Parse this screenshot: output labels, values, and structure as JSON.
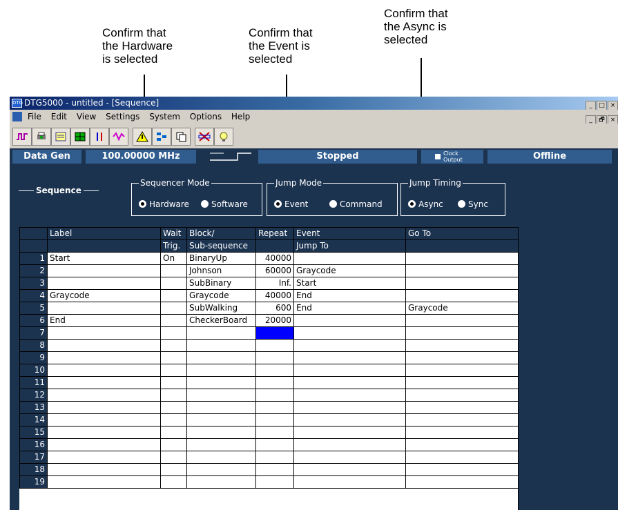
{
  "callouts": [
    {
      "lines": [
        "Confirm that",
        "the Hardware",
        "is selected"
      ]
    },
    {
      "lines": [
        "Confirm that",
        "the Event is",
        "selected"
      ]
    },
    {
      "lines": [
        "Confirm that",
        "the Async is",
        "selected"
      ]
    }
  ],
  "window": {
    "title": "DTG5000 - untitled - [Sequence]",
    "app_icon": "dtg-app-icon",
    "controls": {
      "minimize": "_",
      "maximize": "□",
      "close": "×",
      "restore": "🗗"
    }
  },
  "menu": [
    "File",
    "Edit",
    "View",
    "Settings",
    "System",
    "Options",
    "Help"
  ],
  "toolbar_icons": [
    "waveform-icon",
    "print-icon",
    "listing-icon",
    "grid-icon",
    "timing-icon",
    "pattern-icon",
    "warning-icon",
    "sequence-icon",
    "copy-icon",
    "scope-icon",
    "probe-icon"
  ],
  "status": {
    "mode": "Data Gen",
    "frequency": "100.00000 MHz",
    "run_state": "Stopped",
    "clock_output": "Clock Output",
    "connection": "Offline"
  },
  "sequence_label": "Sequence",
  "sequencer_mode": {
    "title": "Sequencer Mode",
    "options": [
      "Hardware",
      "Software"
    ],
    "selected": "Hardware"
  },
  "jump_mode": {
    "title": "Jump Mode",
    "options": [
      "Event",
      "Command"
    ],
    "selected": "Event"
  },
  "jump_timing": {
    "title": "Jump Timing",
    "options": [
      "Async",
      "Sync"
    ],
    "selected": "Async"
  },
  "table": {
    "header1": [
      "",
      "Label",
      "Wait",
      "Block/",
      "Repeat",
      "Event",
      "Go To"
    ],
    "header2": [
      "",
      "",
      "Trig.",
      "Sub-sequence",
      "",
      "Jump To",
      ""
    ],
    "rows": [
      [
        "1",
        "Start",
        "On",
        "BinaryUp",
        "40000",
        "",
        ""
      ],
      [
        "2",
        "",
        "",
        "Johnson",
        "60000",
        "Graycode",
        ""
      ],
      [
        "3",
        "",
        "",
        "SubBinary",
        "Inf.",
        "Start",
        ""
      ],
      [
        "4",
        "Graycode",
        "",
        "Graycode",
        "40000",
        "End",
        ""
      ],
      [
        "5",
        "",
        "",
        "SubWalking",
        "600",
        "End",
        "Graycode"
      ],
      [
        "6",
        "End",
        "",
        "CheckerBoard",
        "20000",
        "",
        ""
      ],
      [
        "7",
        "",
        "",
        "",
        "",
        "",
        ""
      ],
      [
        "8",
        "",
        "",
        "",
        "",
        "",
        ""
      ],
      [
        "9",
        "",
        "",
        "",
        "",
        "",
        ""
      ],
      [
        "10",
        "",
        "",
        "",
        "",
        "",
        ""
      ],
      [
        "11",
        "",
        "",
        "",
        "",
        "",
        ""
      ],
      [
        "12",
        "",
        "",
        "",
        "",
        "",
        ""
      ],
      [
        "13",
        "",
        "",
        "",
        "",
        "",
        ""
      ],
      [
        "14",
        "",
        "",
        "",
        "",
        "",
        ""
      ],
      [
        "15",
        "",
        "",
        "",
        "",
        "",
        ""
      ],
      [
        "16",
        "",
        "",
        "",
        "",
        "",
        ""
      ],
      [
        "17",
        "",
        "",
        "",
        "",
        "",
        ""
      ],
      [
        "18",
        "",
        "",
        "",
        "",
        "",
        ""
      ],
      [
        "19",
        "",
        "",
        "",
        "",
        "",
        ""
      ]
    ],
    "selected_cell": {
      "row": 7,
      "column": "Repeat"
    }
  },
  "colors": {
    "panel_bg": "#1c3350",
    "selection": "#0000ff"
  }
}
